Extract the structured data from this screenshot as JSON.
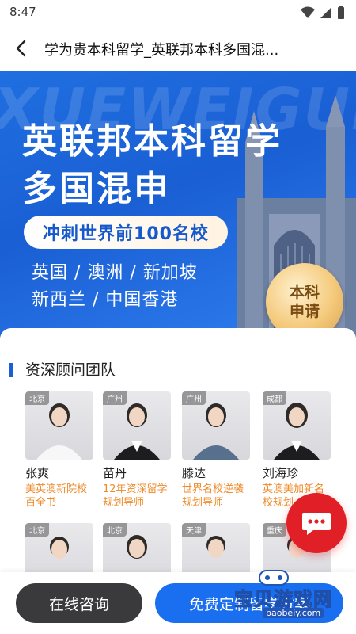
{
  "status_bar": {
    "time": "8:47"
  },
  "nav": {
    "title": "学为贵本科留学_英联邦本科多国混..."
  },
  "banner": {
    "watermark": "XUEWEIGUI",
    "title_line1": "英联邦本科留学",
    "title_line2": "多国混申",
    "pill": "冲刺世界前100名校",
    "regions_line1": "英国 / 澳洲 / 新加坡",
    "regions_line2": "新西兰 / 中国香港",
    "seal_line1": "本科",
    "seal_line2": "申请"
  },
  "section": {
    "title": "资深顾问团队"
  },
  "advisors": [
    {
      "city": "北京",
      "name": "张爽",
      "desc": "美英澳新院校百全书"
    },
    {
      "city": "广州",
      "name": "苗丹",
      "desc": "12年资深留学规划导师"
    },
    {
      "city": "广州",
      "name": "滕达",
      "desc": "世界名校逆袭规划导师"
    },
    {
      "city": "成都",
      "name": "刘海珍",
      "desc": "英澳美加新名校规划"
    },
    {
      "city": "北京",
      "name": "",
      "desc": ""
    },
    {
      "city": "北京",
      "name": "",
      "desc": ""
    },
    {
      "city": "天津",
      "name": "",
      "desc": ""
    },
    {
      "city": "重庆",
      "name": "",
      "desc": ""
    }
  ],
  "bottom": {
    "consult_label": "在线咨询",
    "free_label": "免费定制留学方案"
  },
  "watermark_logo": {
    "text": "宝贝游戏网",
    "url": "baobeiy.com"
  },
  "colors": {
    "primary": "#1a6ff0",
    "accent_orange": "#ef8a2a",
    "chat_red": "#e11f26",
    "dark_button": "#3a3a3d"
  }
}
